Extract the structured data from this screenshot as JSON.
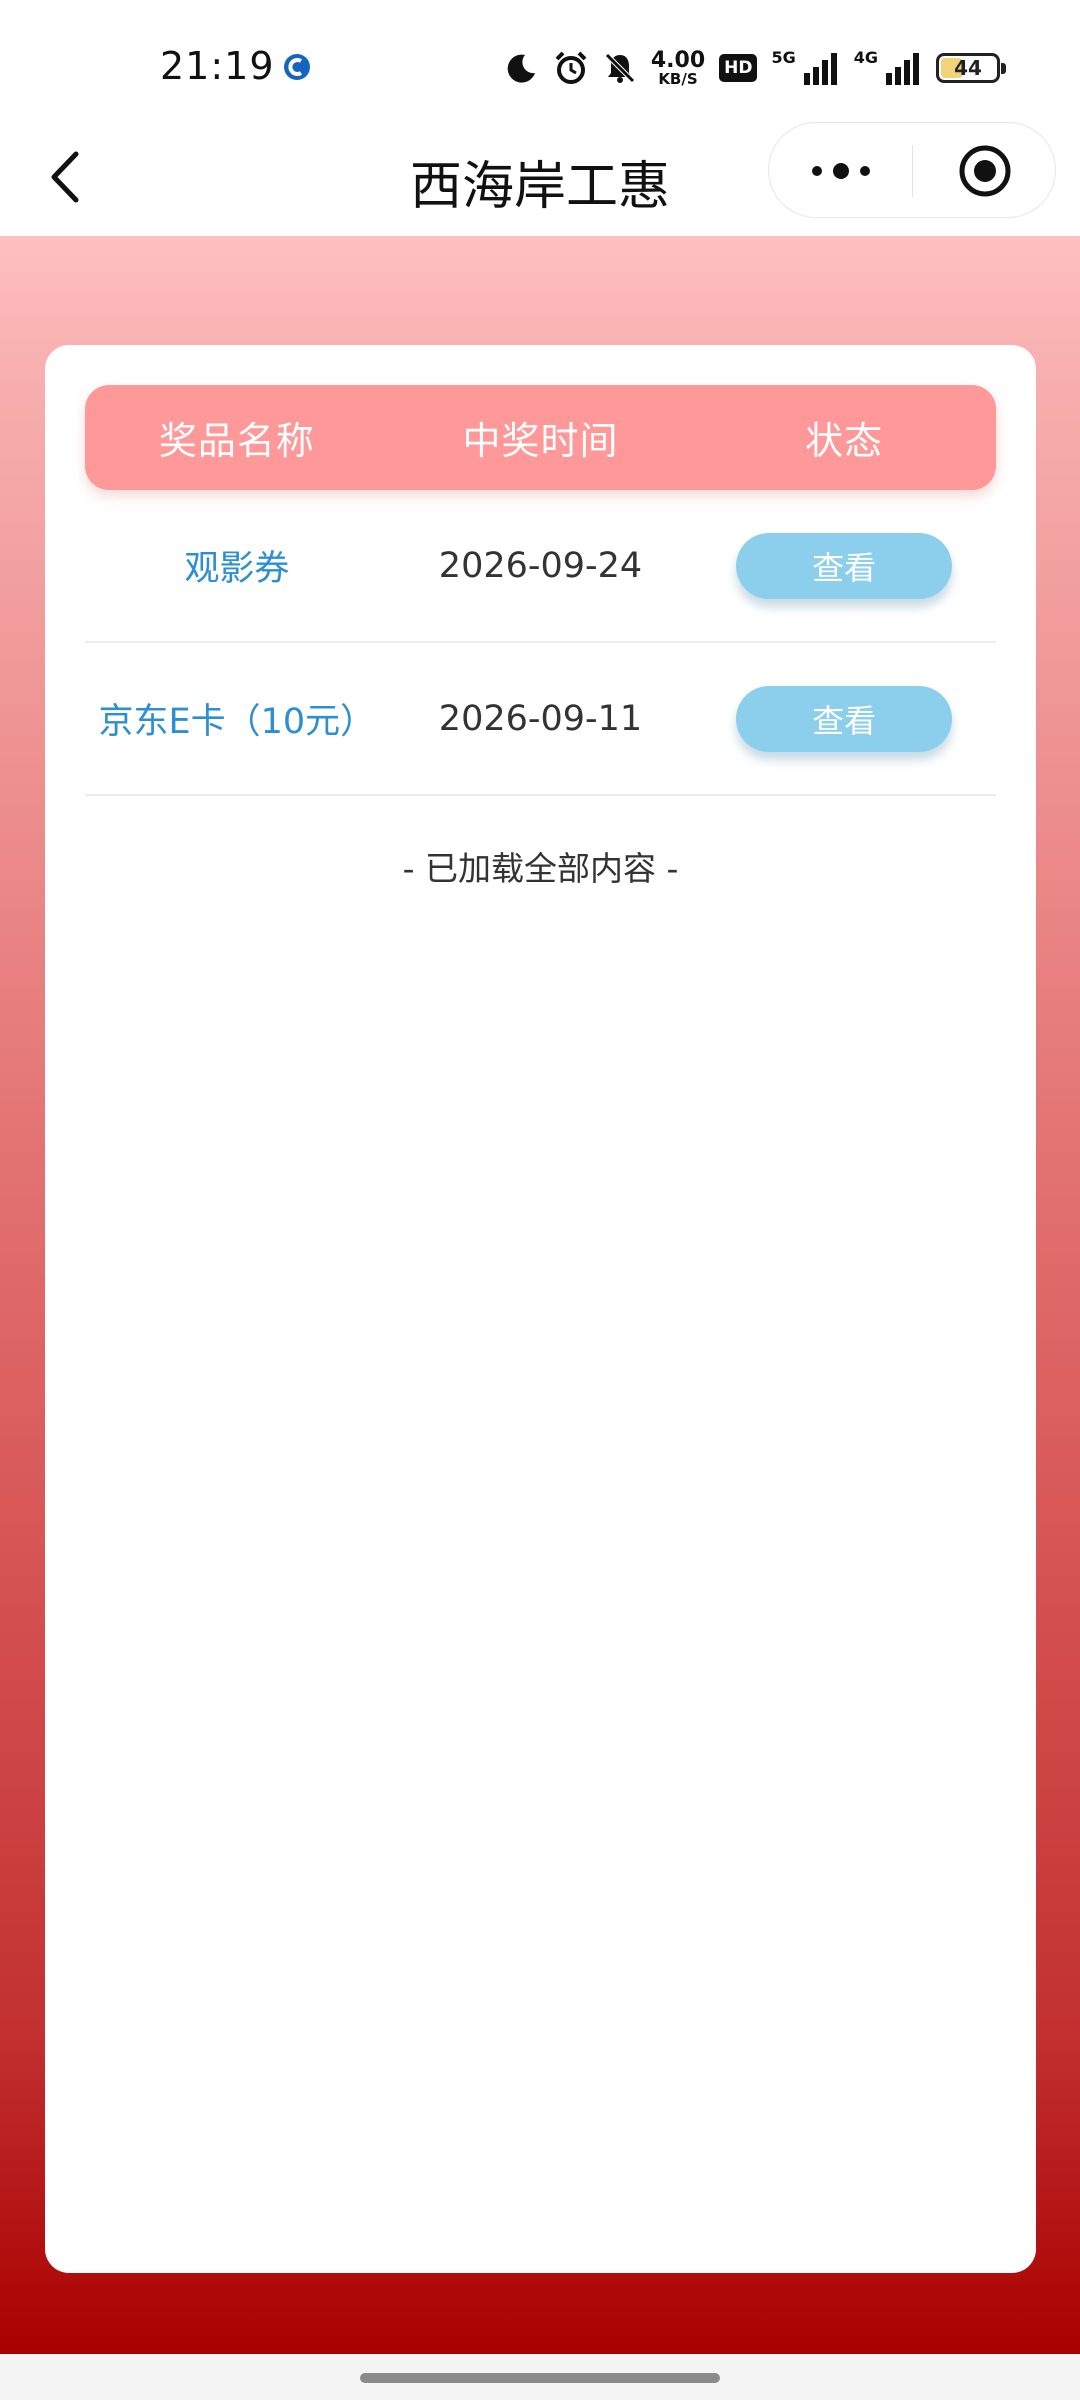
{
  "status_bar": {
    "time": "21:19",
    "net_speed_value": "4.00",
    "net_speed_unit": "KB/S",
    "hd_label": "HD",
    "signal1_label": "5G",
    "signal2_label": "4G",
    "battery_level": "44"
  },
  "nav": {
    "title": "西海岸工惠"
  },
  "table": {
    "headers": [
      "奖品名称",
      "中奖时间",
      "状态"
    ],
    "rows": [
      {
        "name": "观影券",
        "date": "2026-09-24",
        "action": "查看"
      },
      {
        "name": "京东E卡（10元）",
        "date": "2026-09-11",
        "action": "查看"
      }
    ]
  },
  "load_status": "- 已加载全部内容 -"
}
